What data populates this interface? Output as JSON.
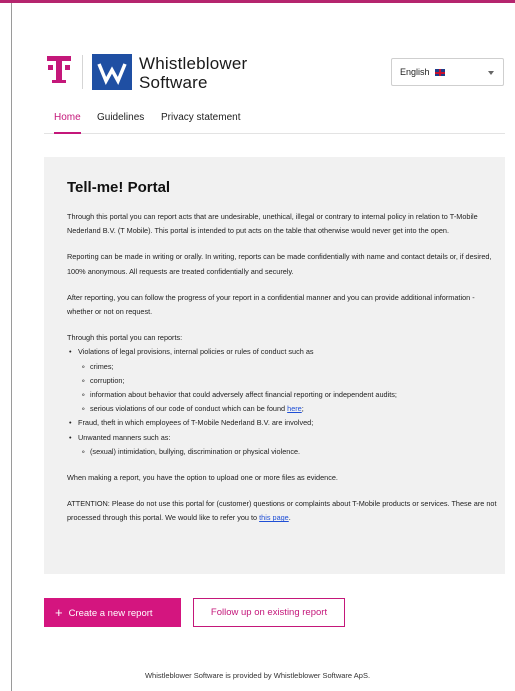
{
  "colors": {
    "brand": "#c4177a",
    "top_bar": "#b5256e",
    "panel_bg": "#f1f1f1",
    "link": "#1f4fd6"
  },
  "header": {
    "brand_line1": "Whistleblower",
    "brand_line2": "Software",
    "logos": [
      "t-mobile-logo",
      "whistleblower-software-logo"
    ]
  },
  "language": {
    "selected": "English",
    "flag": "uk-flag-icon",
    "icon": "chevron-down-icon"
  },
  "nav": {
    "tabs": [
      "Home",
      "Guidelines",
      "Privacy statement"
    ],
    "active": "Home"
  },
  "content": {
    "title": "Tell-me! Portal",
    "p1": "Through this portal you can report acts that are undesirable, unethical, illegal or contrary to internal policy in relation to T-Mobile Nederland B.V. (T Mobile). This portal is intended to put acts on the table that otherwise would never get into the open.",
    "p2": "Reporting can be made in writing or orally. In writing, reports can be made confidentially with name and contact details or, if desired, 100% anonymous. All requests are treated confidentially and securely.",
    "p3": "After reporting, you can follow the progress of your report in a confidential manner and you can provide additional information - whether or not on request.",
    "list_intro": "Through this portal you can reports:",
    "list": {
      "item1": "Violations of legal provisions, internal policies or rules of conduct such as",
      "item1_sub": [
        "crimes;",
        "corruption;",
        "information about behavior that could adversely affect financial reporting or independent audits;"
      ],
      "item1_sub4_pre": "serious violations of our code of conduct which can be found ",
      "item1_sub4_link": "here",
      "item1_sub4_post": ";",
      "item2": "Fraud, theft in which employees of T-Mobile Nederland B.V. are involved;",
      "item3": "Unwanted manners such as:",
      "item3_sub": "(sexual) intimidation, bullying, discrimination or physical violence."
    },
    "p4": "When making a report, you have the option to upload one or more files as evidence.",
    "p5_pre": "ATTENTION: Please do not use this portal for (customer) questions or complaints about T-Mobile products or services. These are not processed through this portal. We would like to refer you to ",
    "p5_link": "this page",
    "p5_post": "."
  },
  "actions": {
    "create_label": "Create a new report",
    "create_icon": "plus-icon",
    "follow_label": "Follow up on existing report"
  },
  "footer": {
    "text": "Whistleblower Software is provided by Whistleblower Software ApS."
  }
}
